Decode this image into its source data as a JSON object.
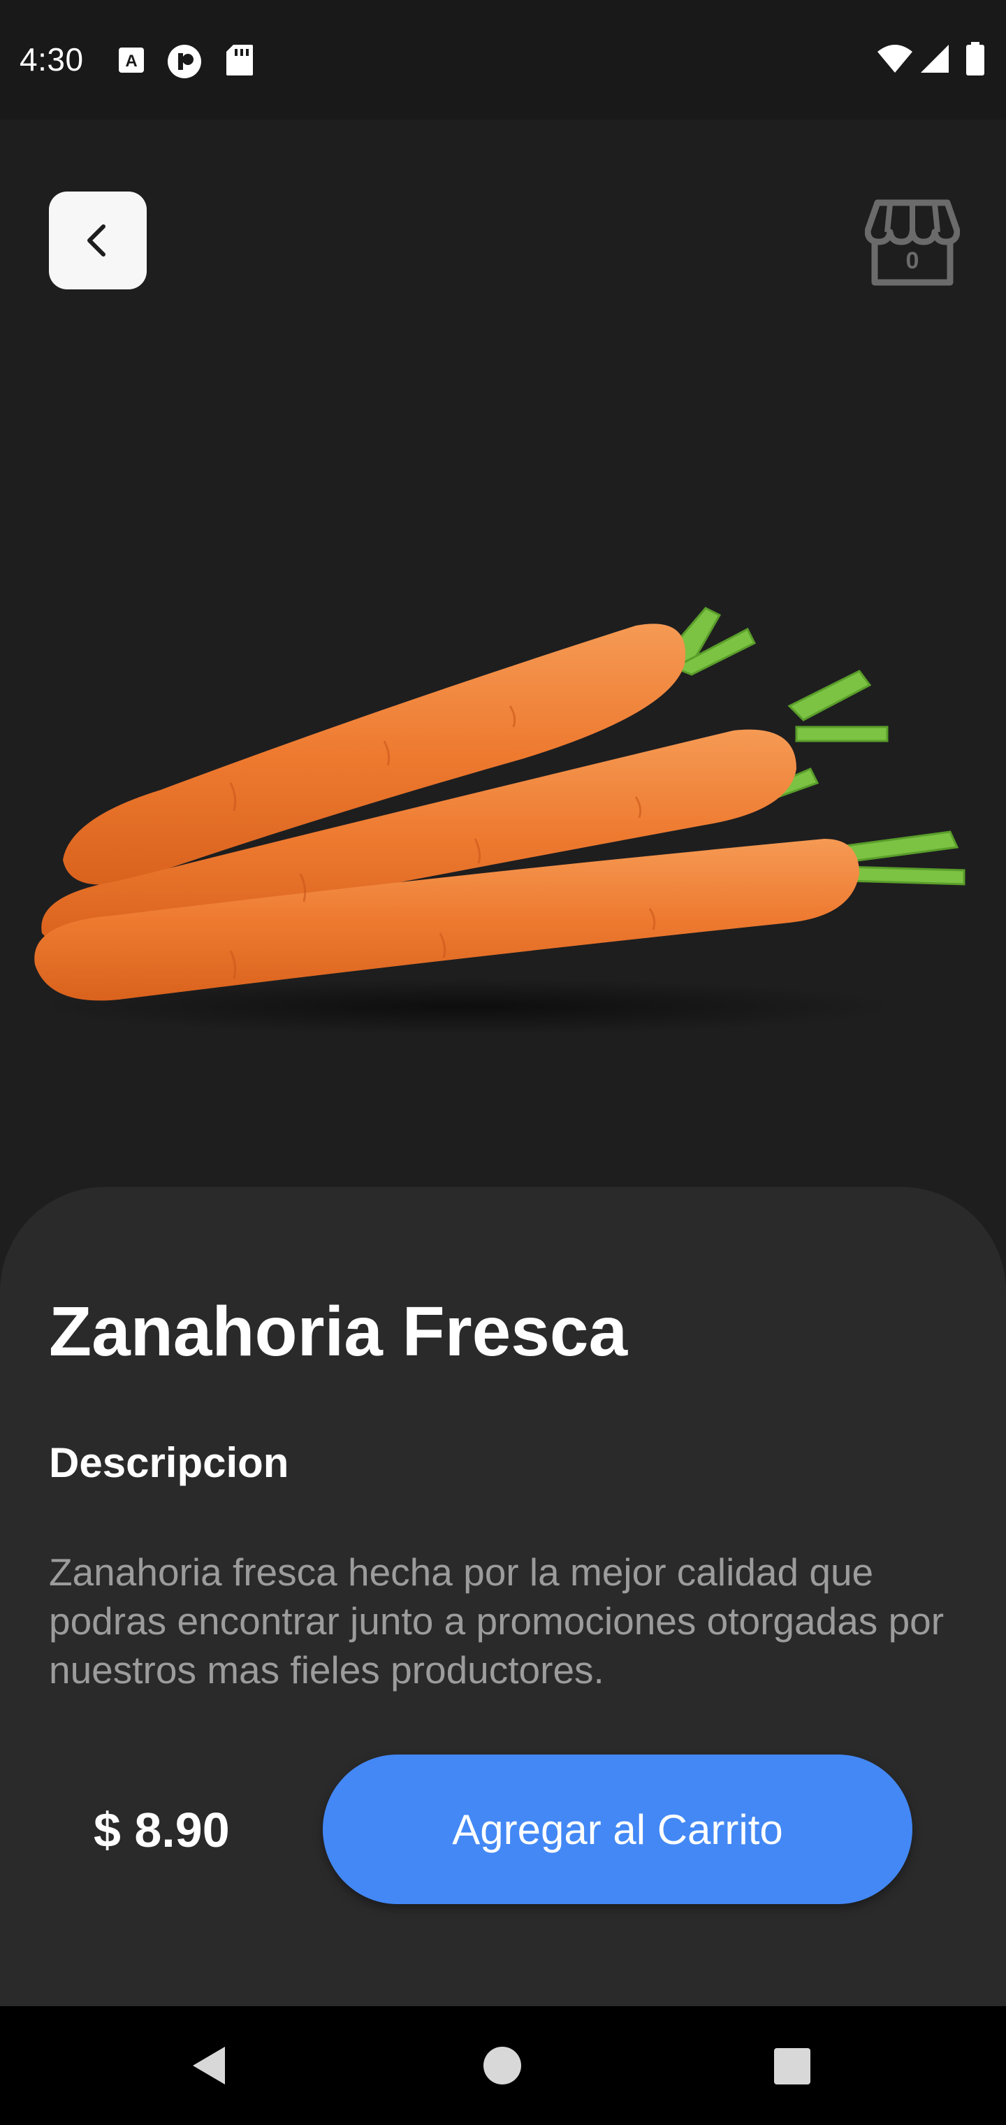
{
  "status_bar": {
    "time": "4:30",
    "icons": [
      "a-notification-icon",
      "pocket-casts-icon",
      "sd-card-icon",
      "wifi-icon",
      "signal-icon",
      "battery-icon"
    ]
  },
  "header": {
    "back_icon": "chevron-left-icon",
    "store_icon": "store-icon",
    "cart_count": "0"
  },
  "product": {
    "image": "carrots",
    "name": "Zanahoria Fresca",
    "description_heading": "Descripcion",
    "description": "Zanahoria fresca hecha por la mejor calidad que podras encontrar junto a promociones otorgadas por nuestros mas fieles productores.",
    "price": "$ 8.90",
    "add_to_cart_label": "Agregar al Carrito"
  },
  "nav_bar": {
    "items": [
      "back-triangle-icon",
      "home-circle-icon",
      "recents-square-icon"
    ]
  },
  "colors": {
    "background": "#1e1e1f",
    "sheet": "#2a2a2b",
    "accent": "#4388f5",
    "muted_text": "#9c9c9d"
  }
}
